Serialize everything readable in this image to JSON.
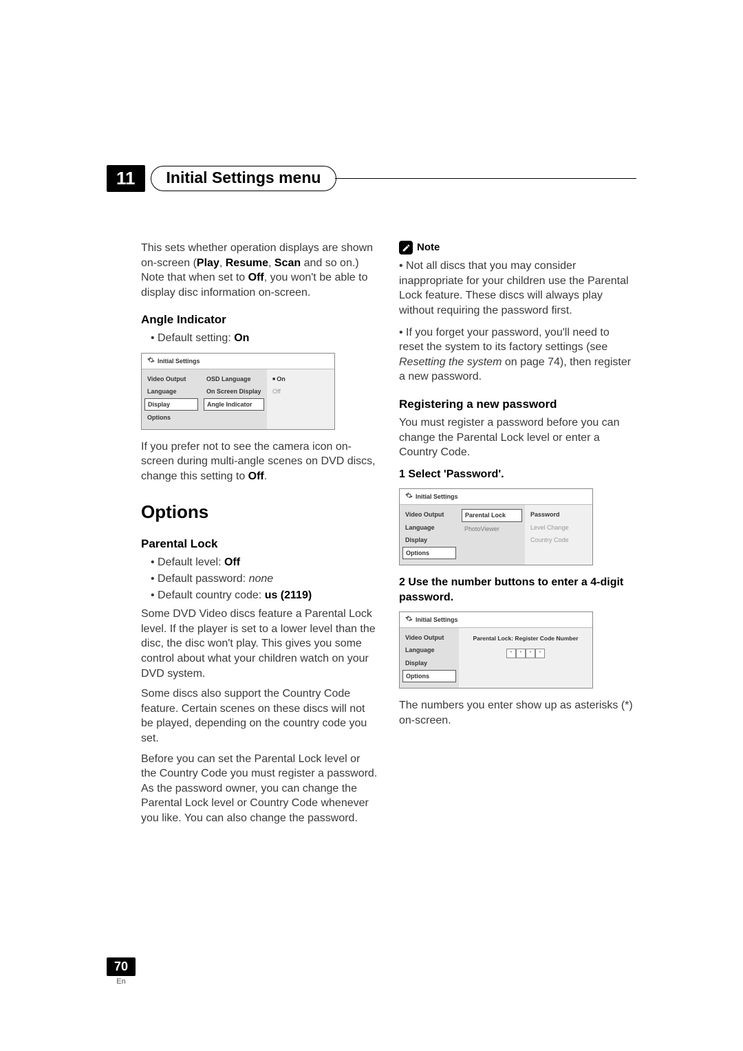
{
  "chapter": {
    "num": "11",
    "title": "Initial Settings menu"
  },
  "left": {
    "intro": "This sets whether operation displays are shown on-screen (",
    "intro_b1": "Play",
    "intro_c1": ", ",
    "intro_b2": "Resume",
    "intro_c2": ", ",
    "intro_b3": "Scan",
    "intro_tail1": " and so on.) Note that when set to ",
    "intro_b4": "Off",
    "intro_tail2": ", you won't be able to display disc information on-screen.",
    "angle_heading": "Angle Indicator",
    "default_on_prefix": "Default setting: ",
    "default_on_val": "On",
    "osd1": {
      "title": "Initial Settings",
      "nav": [
        "Video Output",
        "Language",
        "Display",
        "Options"
      ],
      "sub": [
        "OSD Language",
        "On Screen Display",
        "Angle Indicator"
      ],
      "vals": [
        "On",
        "Off"
      ]
    },
    "angle_text1": "If you prefer not to see the camera icon on-screen during multi-angle scenes on DVD discs, change this setting to ",
    "angle_text_b": "Off",
    "angle_text_tail": ".",
    "options_heading": "Options",
    "parental_heading": "Parental Lock",
    "pl_b1_pre": "Default level: ",
    "pl_b1_val": "Off",
    "pl_b2_pre": "Default password: ",
    "pl_b2_val": "none",
    "pl_b3_pre": "Default country code: ",
    "pl_b3_val": "us (2119)",
    "pl_p1": "Some DVD Video discs feature a Parental Lock level. If the player is set to a lower level than the disc, the disc won't play. This gives you some control about what your children watch on your DVD system.",
    "pl_p2": "Some discs also support the Country Code feature. Certain scenes on these discs will not be played, depending on the country code you set.",
    "pl_p3": "Before you can set the Parental Lock level or the Country Code you must register a password. As the password owner, you can change the Parental Lock level or Country Code whenever you like. You can also change the password."
  },
  "right": {
    "note_label": "Note",
    "note1": "Not all discs that you may consider inappropriate for your children use the Parental Lock feature. These discs will always play without requiring the password first.",
    "note2_a": "If you forget your password, you'll need to reset the system to its factory settings (see ",
    "note2_i": "Resetting the system",
    "note2_b": " on page 74), then register a new password.",
    "reg_heading": "Registering a new password",
    "reg_intro": "You must register a password before you can change the Parental Lock level or enter a Country Code.",
    "step1": "1    Select 'Password'.",
    "osd2": {
      "title": "Initial Settings",
      "nav": [
        "Video Output",
        "Language",
        "Display",
        "Options"
      ],
      "sub": [
        "Parental Lock",
        "PhotoViewer"
      ],
      "vals": [
        "Password",
        "Level Change",
        "Country Code"
      ]
    },
    "step2": "2    Use the number buttons to enter a 4-digit password.",
    "osd3": {
      "title": "Initial Settings",
      "nav": [
        "Video Output",
        "Language",
        "Display",
        "Options"
      ],
      "right_title": "Parental Lock: Register Code Number",
      "stars": [
        "*",
        "*",
        "*",
        "*"
      ]
    },
    "closing": "The numbers you enter show up as asterisks (*) on-screen."
  },
  "footer": {
    "page": "70",
    "lang": "En"
  }
}
